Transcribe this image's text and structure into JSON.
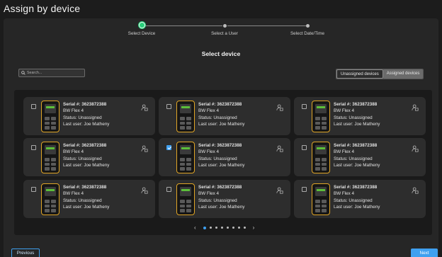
{
  "page": {
    "title": "Assign by device"
  },
  "stepper": {
    "steps": [
      {
        "label": "Select Device",
        "active": true
      },
      {
        "label": "Select a User",
        "active": false
      },
      {
        "label": "Select Date/Time",
        "active": false
      }
    ]
  },
  "section": {
    "title": "Select device"
  },
  "search": {
    "placeholder": "Search..."
  },
  "filter_toggle": {
    "options": [
      "Unassigned devices",
      "Assigned devices"
    ],
    "selected": "Unassigned devices"
  },
  "devices": [
    {
      "serial": "Serial #: 3623872388",
      "model": "BW Flex 4",
      "status": "Status: Unassigned",
      "last_user": "Last user: Joe Matheny",
      "checked": false
    },
    {
      "serial": "Serial #: 3623872388",
      "model": "BW Flex 4",
      "status": "Status: Unassigned",
      "last_user": "Last user: Joe Matheny",
      "checked": false
    },
    {
      "serial": "Serial #: 3623872388",
      "model": "BW Flex 4",
      "status": "Status: Unassigned",
      "last_user": "Last user: Joe Matheny",
      "checked": false
    },
    {
      "serial": "Serial #: 3623872388",
      "model": "BW Flex 4",
      "status": "Status: Unassigned",
      "last_user": "Last user: Joe Matheny",
      "checked": false
    },
    {
      "serial": "Serial #: 3623872388",
      "model": "BW Flex 4",
      "status": "Status: Unassigned",
      "last_user": "Last user: Joe Matheny",
      "checked": true
    },
    {
      "serial": "Serial #: 3623872388",
      "model": "BW Flex 4",
      "status": "Status: Unassigned",
      "last_user": "Last user: Joe Matheny",
      "checked": false
    },
    {
      "serial": "Serial #: 3623872388",
      "model": "BW Flex 4",
      "status": "Status: Unassigned",
      "last_user": "Last user: Joe Matheny",
      "checked": false
    },
    {
      "serial": "Serial #: 3623872388",
      "model": "BW Flex 4",
      "status": "Status: Unassigned",
      "last_user": "Last user: Joe Matheny",
      "checked": false
    },
    {
      "serial": "Serial #: 3623872388",
      "model": "BW Flex 4",
      "status": "Status: Unassigned",
      "last_user": "Last user: Joe Matheny",
      "checked": false
    }
  ],
  "pagination": {
    "pages": 8,
    "current": 1
  },
  "buttons": {
    "previous": "Previous",
    "next": "Next"
  },
  "colors": {
    "accent": "#3fa0f0",
    "active_step": "#27d07a",
    "device_outline": "#e0a526"
  },
  "icons": {
    "search": "search-icon",
    "assign_user": "user-assign-icon",
    "prev_page": "chevron-left-icon",
    "next_page": "chevron-right-icon"
  }
}
